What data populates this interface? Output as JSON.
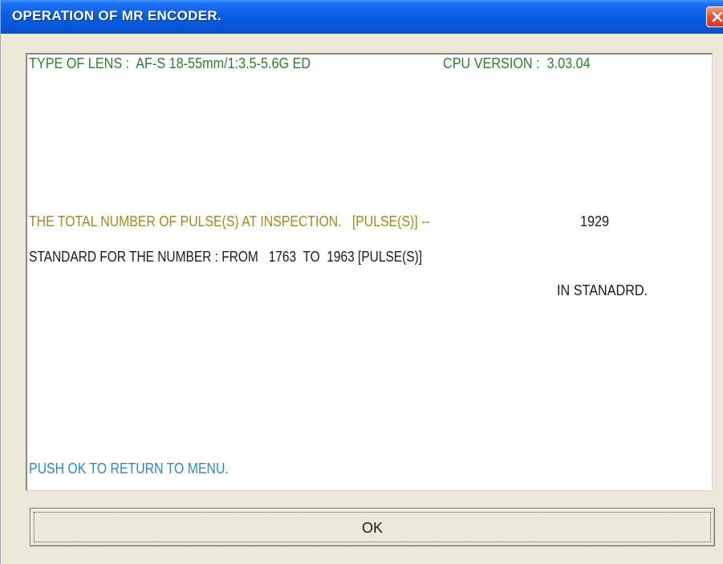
{
  "window": {
    "title": "OPERATION OF MR ENCODER."
  },
  "panel": {
    "lens_line": "TYPE OF LENS :  AF-S 18-55mm/1:3.5-5.6G ED",
    "cpu_line": "CPU VERSION :  3.03.04",
    "pulse_line": "THE TOTAL NUMBER OF PULSE(S) AT INSPECTION.   [PULSE(S)] --",
    "pulse_value": "1929",
    "standard_line": "STANDARD FOR THE NUMBER : FROM   1763  TO  1963 [PULSE(S)]",
    "result": "IN STANADRD.",
    "instruction": "PUSH OK TO RETURN TO MENU."
  },
  "buttons": {
    "ok_label": "OK"
  },
  "colors": {
    "info_text": "#2e7d2e",
    "measurement_text": "#9c8a1a",
    "body_text": "#1a1a1a",
    "instruction_text": "#2f86c6",
    "titlebar": "#0a5ce0"
  },
  "icons": {
    "close": "close-icon"
  }
}
